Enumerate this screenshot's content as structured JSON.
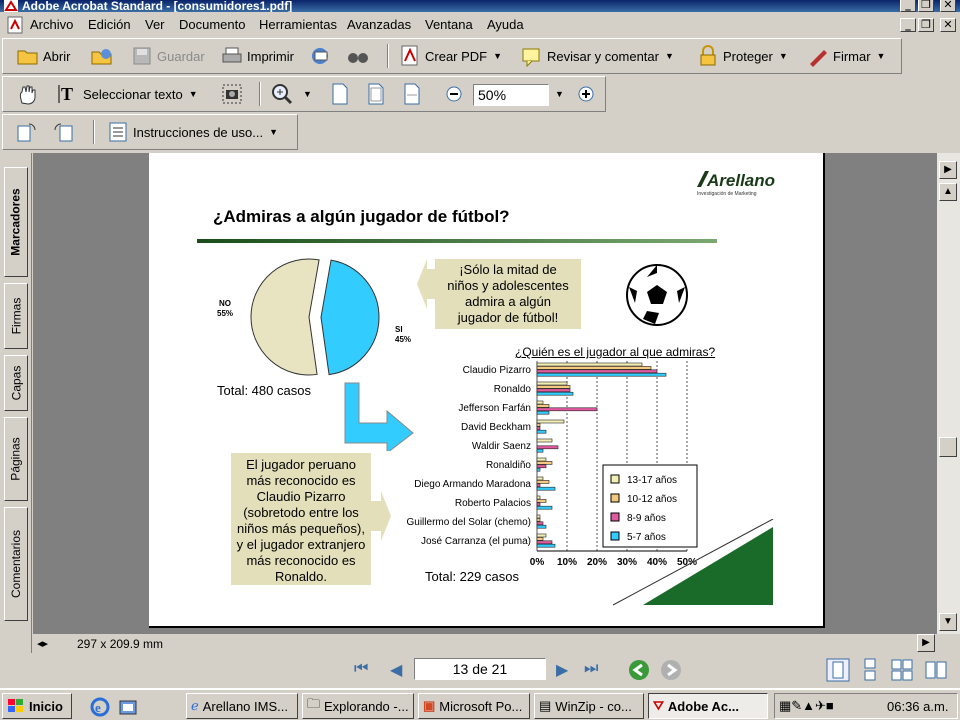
{
  "window": {
    "title": "Adobe Acrobat Standard - [consumidores1.pdf]"
  },
  "menu": [
    "Archivo",
    "Edición",
    "Ver",
    "Documento",
    "Herramientas",
    "Avanzadas",
    "Ventana",
    "Ayuda"
  ],
  "toolbar1": {
    "open": "Abrir",
    "save": "Guardar",
    "print": "Imprimir",
    "create_pdf": "Crear PDF",
    "review": "Revisar y comentar",
    "protect": "Proteger",
    "sign": "Firmar"
  },
  "toolbar2": {
    "select_text": "Seleccionar texto",
    "zoom": "50%"
  },
  "toolbar3": {
    "instructions": "Instrucciones de uso..."
  },
  "nav_tabs": [
    "Marcadores",
    "Firmas",
    "Capas",
    "Páginas",
    "Comentarios"
  ],
  "status": {
    "page_size": "297 x 209.9 mm"
  },
  "navigation": {
    "page_indicator": "13 de 21"
  },
  "taskbar": {
    "start": "Inicio",
    "tasks": [
      "Arellano IMS...",
      "Explorando -...",
      "Microsoft Po...",
      "WinZip - co...",
      "Adobe Ac..."
    ],
    "clock": "06:36 a.m."
  },
  "slide": {
    "logo": "Arellano",
    "logo_sub": "Investigación de Marketing",
    "title": "¿Admiras a algún jugador de fútbol?",
    "pie_total": "Total: 480 casos",
    "callout1": [
      "¡Sólo la mitad de",
      "niños y adolescentes",
      "admira a algún",
      "jugador de fútbol!"
    ],
    "callout2": [
      "El jugador peruano",
      "más reconocido es",
      "Claudio Pizarro",
      "(sobretodo entre los",
      "niños más pequeños),",
      "y el jugador extranjero",
      "más reconocido es",
      "Ronaldo."
    ],
    "bar_title": "¿Quién es el jugador al que admiras?",
    "bar_total": "Total: 229 casos"
  },
  "chart_data": [
    {
      "type": "pie",
      "categories": [
        "NO",
        "SI"
      ],
      "values": [
        55,
        45
      ],
      "labels": [
        "NO\n55%",
        "SI\n45%"
      ],
      "colors": [
        "#e8e4c2",
        "#33ccff"
      ]
    },
    {
      "type": "bar",
      "orientation": "horizontal",
      "title": "¿Quién es el jugador al que admiras?",
      "categories": [
        "Claudio Pizarro",
        "Ronaldo",
        "Jefferson Farfán",
        "David Beckham",
        "Waldir Saenz",
        "Ronaldiño",
        "Diego Armando Maradona",
        "Roberto Palacios",
        "Guillermo del Solar (chemo)",
        "José Carranza (el puma)"
      ],
      "series": [
        {
          "name": "13-17 años",
          "color": "#f2efb3",
          "values": [
            35,
            10,
            2,
            9,
            5,
            3,
            2,
            1,
            1,
            3
          ]
        },
        {
          "name": "10-12 años",
          "color": "#f5c880",
          "values": [
            38,
            11,
            4,
            1,
            0,
            5,
            4,
            3,
            1,
            2
          ]
        },
        {
          "name": "8-9 años",
          "color": "#e05aa0",
          "values": [
            40,
            11,
            20,
            1,
            7,
            3,
            1,
            1,
            2,
            5
          ]
        },
        {
          "name": "5-7 años",
          "color": "#33ccff",
          "values": [
            43,
            12,
            4,
            3,
            2,
            1,
            6,
            5,
            3,
            6
          ]
        }
      ],
      "xticks": [
        "0%",
        "10%",
        "20%",
        "30%",
        "40%",
        "50%"
      ],
      "xlim": [
        0,
        50
      ],
      "legend": "inside-bottom-right"
    }
  ]
}
